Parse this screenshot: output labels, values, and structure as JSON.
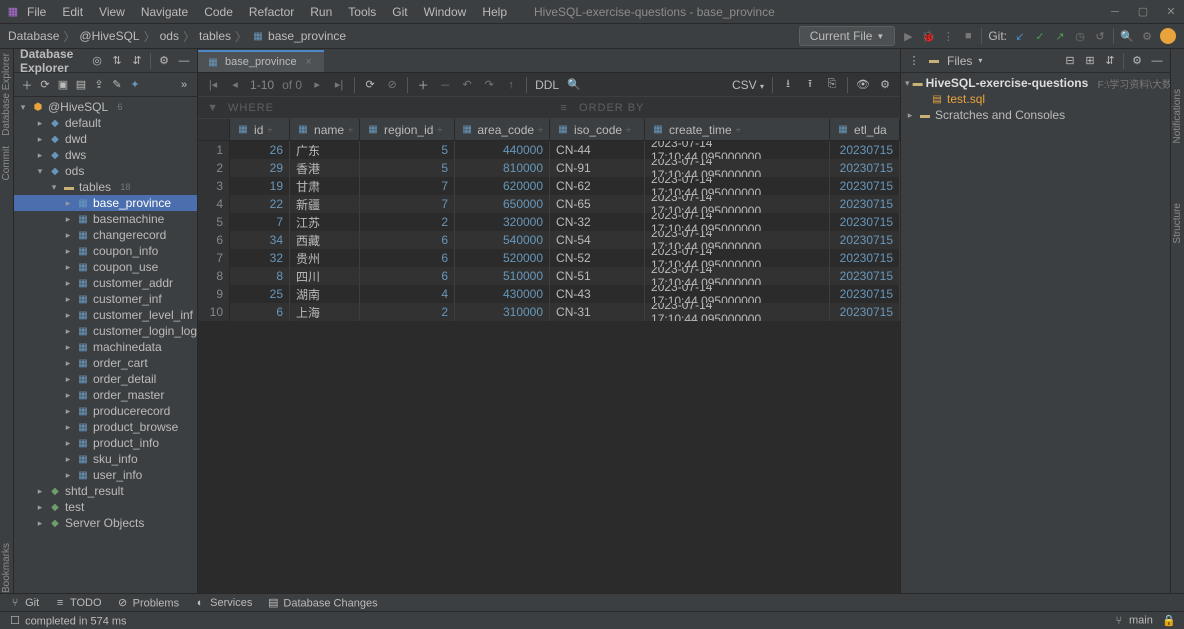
{
  "window": {
    "title": "HiveSQL-exercise-questions - base_province"
  },
  "menu": [
    "File",
    "Edit",
    "View",
    "Navigate",
    "Code",
    "Refactor",
    "Run",
    "Tools",
    "Git",
    "Window",
    "Help"
  ],
  "breadcrumb": [
    "Database",
    "@HiveSQL",
    "ods",
    "tables",
    "base_province"
  ],
  "runbar": {
    "config": "Current File",
    "git_label": "Git:"
  },
  "explorer": {
    "title": "Database Explorer",
    "root": {
      "label": "@HiveSQL",
      "badge": "6"
    },
    "schemas": [
      "default",
      "dwd",
      "dws"
    ],
    "ods_label": "ods",
    "tables_label": "tables",
    "tables_badge": "18",
    "tables": [
      "base_province",
      "basemachine",
      "changerecord",
      "coupon_info",
      "coupon_use",
      "customer_addr",
      "customer_inf",
      "customer_level_inf",
      "customer_login_log",
      "machinedata",
      "order_cart",
      "order_detail",
      "order_master",
      "producerecord",
      "product_browse",
      "product_info",
      "sku_info",
      "user_info"
    ],
    "after": [
      "shtd_result",
      "test",
      "Server Objects"
    ]
  },
  "tab": {
    "label": "base_province"
  },
  "data_toolbar": {
    "pager": "1-10",
    "of": "of 0",
    "ddl": "DDL",
    "format": "CSV"
  },
  "filter": {
    "where": "WHERE",
    "orderby": "ORDER BY"
  },
  "columns": [
    "id",
    "name",
    "region_id",
    "area_code",
    "iso_code",
    "create_time",
    "etl_da"
  ],
  "rows": [
    {
      "id": 26,
      "name": "广东",
      "region_id": 5,
      "area_code": "440000",
      "iso_code": "CN-44",
      "create_time": "2023-07-14 17:10:44.095000000",
      "etl": "20230715"
    },
    {
      "id": 29,
      "name": "香港",
      "region_id": 5,
      "area_code": "810000",
      "iso_code": "CN-91",
      "create_time": "2023-07-14 17:10:44.095000000",
      "etl": "20230715"
    },
    {
      "id": 19,
      "name": "甘肃",
      "region_id": 7,
      "area_code": "620000",
      "iso_code": "CN-62",
      "create_time": "2023-07-14 17:10:44.095000000",
      "etl": "20230715"
    },
    {
      "id": 22,
      "name": "新疆",
      "region_id": 7,
      "area_code": "650000",
      "iso_code": "CN-65",
      "create_time": "2023-07-14 17:10:44.095000000",
      "etl": "20230715"
    },
    {
      "id": 7,
      "name": "江苏",
      "region_id": 2,
      "area_code": "320000",
      "iso_code": "CN-32",
      "create_time": "2023-07-14 17:10:44.095000000",
      "etl": "20230715"
    },
    {
      "id": 34,
      "name": "西藏",
      "region_id": 6,
      "area_code": "540000",
      "iso_code": "CN-54",
      "create_time": "2023-07-14 17:10:44.095000000",
      "etl": "20230715"
    },
    {
      "id": 32,
      "name": "贵州",
      "region_id": 6,
      "area_code": "520000",
      "iso_code": "CN-52",
      "create_time": "2023-07-14 17:10:44.095000000",
      "etl": "20230715"
    },
    {
      "id": 8,
      "name": "四川",
      "region_id": 6,
      "area_code": "510000",
      "iso_code": "CN-51",
      "create_time": "2023-07-14 17:10:44.095000000",
      "etl": "20230715"
    },
    {
      "id": 25,
      "name": "湖南",
      "region_id": 4,
      "area_code": "430000",
      "iso_code": "CN-43",
      "create_time": "2023-07-14 17:10:44.095000000",
      "etl": "20230715"
    },
    {
      "id": 6,
      "name": "上海",
      "region_id": 2,
      "area_code": "310000",
      "iso_code": "CN-31",
      "create_time": "2023-07-14 17:10:44.095000000",
      "etl": "20230715"
    }
  ],
  "files_panel": {
    "label": "Files",
    "project": "HiveSQL-exercise-questions",
    "path": "F:\\学习资料\\大数据资料\\",
    "file": "test.sql",
    "scratches": "Scratches and Consoles"
  },
  "side_tabs": {
    "db": "Database Explorer",
    "commit": "Commit",
    "notif": "Notifications",
    "struct": "Structure",
    "files": "Files",
    "bookmarks": "Bookmarks"
  },
  "bottom": {
    "git": "Git",
    "todo": "TODO",
    "problems": "Problems",
    "services": "Services",
    "db_changes": "Database Changes"
  },
  "status": {
    "msg": "completed in 574 ms",
    "branch": "main"
  }
}
